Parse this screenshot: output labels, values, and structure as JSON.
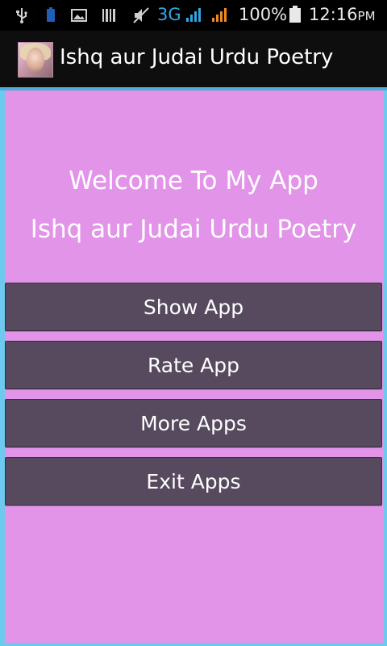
{
  "status_bar": {
    "network_type": "3G",
    "battery_percent": "100%",
    "time": "12:16",
    "ampm": "PM",
    "icons": [
      "usb-icon",
      "battery-saver-icon",
      "image-icon",
      "barcode-icon",
      "mute-icon",
      "signal-icon-sim1",
      "signal-icon-sim2",
      "battery-icon"
    ]
  },
  "action_bar": {
    "title": "Ishq aur Judai Urdu Poetry",
    "icon": "app-icon"
  },
  "main": {
    "welcome_line1": "Welcome To My App",
    "welcome_line2": "Ishq aur Judai Urdu Poetry",
    "buttons": [
      {
        "label": "Show App"
      },
      {
        "label": "Rate App"
      },
      {
        "label": "More Apps"
      },
      {
        "label": "Exit Apps"
      }
    ]
  },
  "colors": {
    "content_background": "#e294e8",
    "button_background": "#574a5f",
    "accent": "#4aaed8",
    "network_3g": "#2fa9e0",
    "signal_sim2": "#f08a1c"
  }
}
